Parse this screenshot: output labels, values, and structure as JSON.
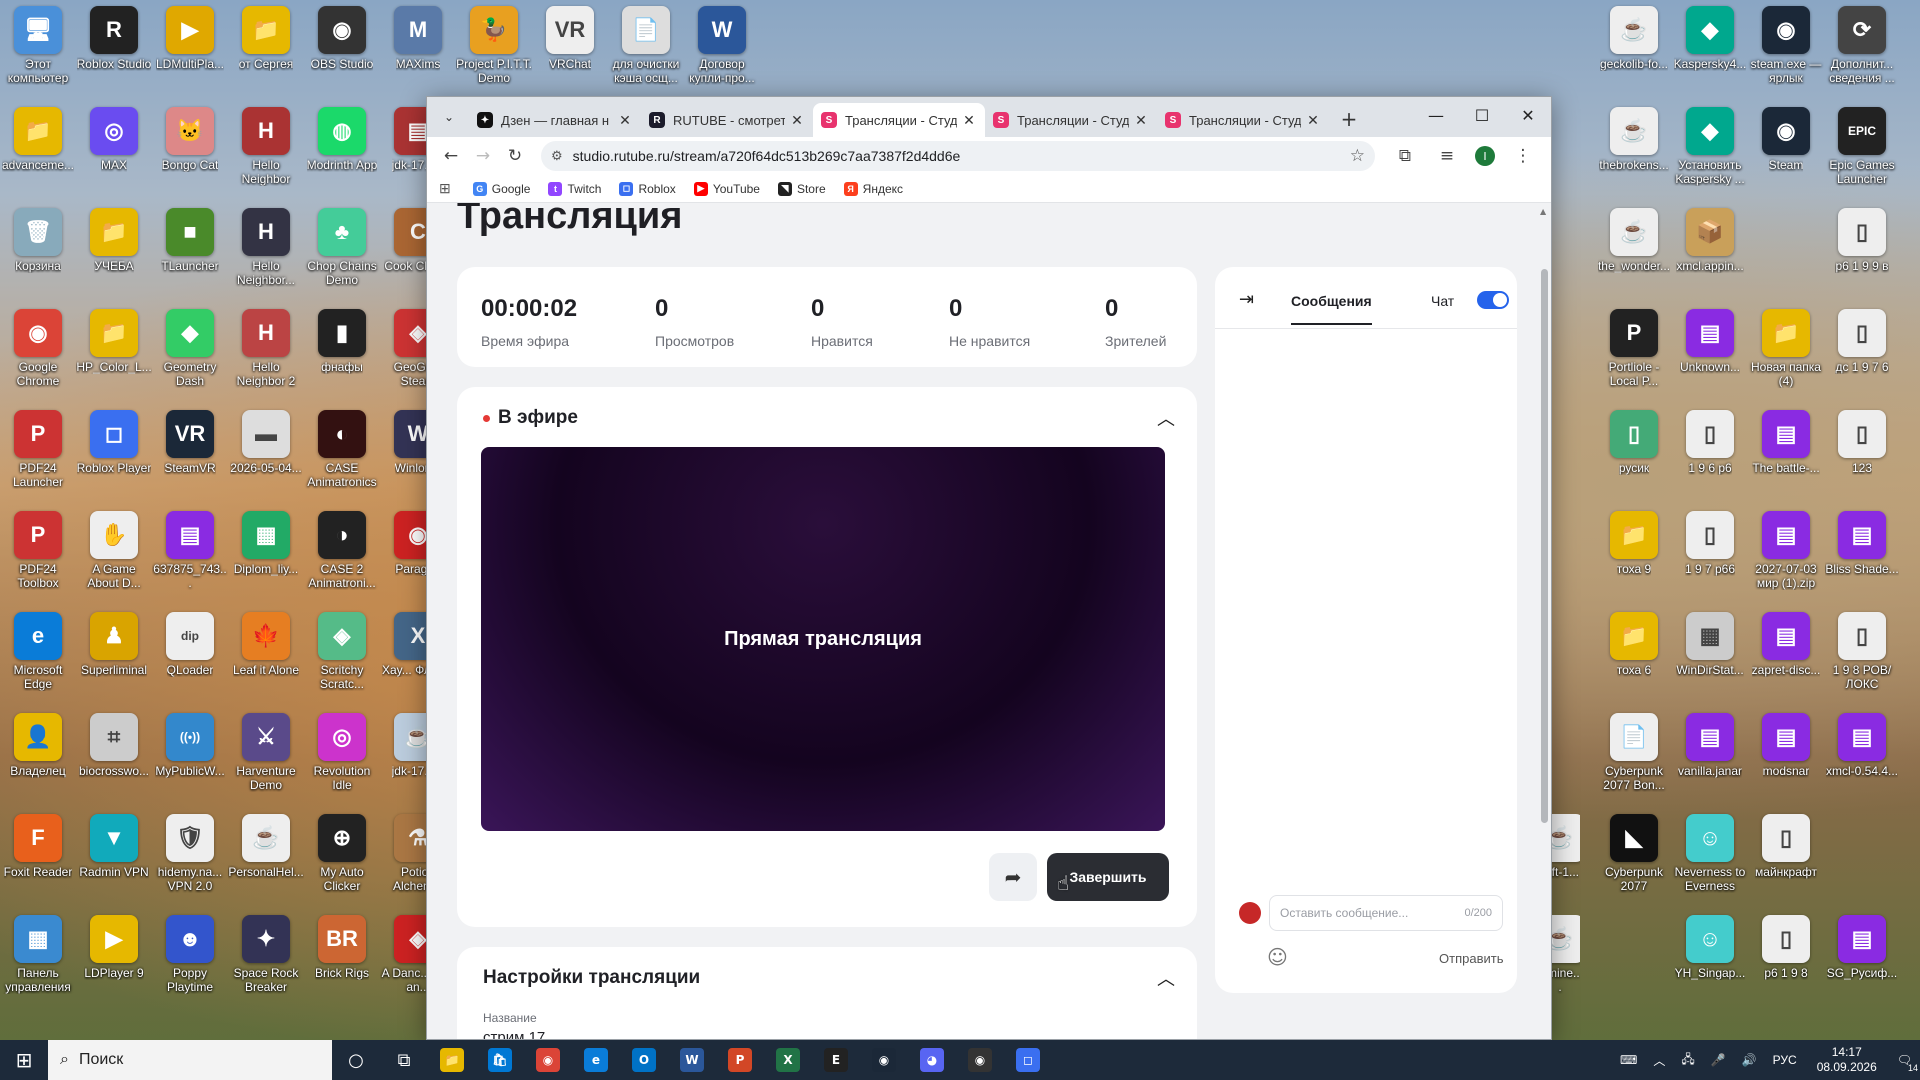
{
  "desktop": {
    "left_icons": [
      {
        "label": "Этот компьютер",
        "color": "#4a90d9",
        "glyph": "🖥",
        "col": 0,
        "row": 0
      },
      {
        "label": "Roblox Studio",
        "color": "#222",
        "glyph": "R",
        "col": 1,
        "row": 0
      },
      {
        "label": "LDMultiPla...",
        "color": "#e0a800",
        "glyph": "▶",
        "col": 2,
        "row": 0
      },
      {
        "label": "от Сергея",
        "color": "#e6b800",
        "glyph": "📁",
        "col": 3,
        "row": 0
      },
      {
        "label": "OBS Studio",
        "color": "#333",
        "glyph": "◉",
        "col": 4,
        "row": 0
      },
      {
        "label": "MAXims",
        "color": "#5a7aa8",
        "glyph": "M",
        "col": 5,
        "row": 0
      },
      {
        "label": "Project P.I.T.T. Demo",
        "color": "#e8a020",
        "glyph": "🦆",
        "col": 6,
        "row": 0
      },
      {
        "label": "VRChat",
        "color": "#eee",
        "glyph": "VR",
        "col": 7,
        "row": 0
      },
      {
        "label": "для очистки кэша осщ...",
        "color": "#ddd",
        "glyph": "📄",
        "col": 8,
        "row": 0
      },
      {
        "label": "Договор купли-про...",
        "color": "#2b579a",
        "glyph": "W",
        "col": 9,
        "row": 0
      },
      {
        "label": "advanceme...",
        "color": "#e6b800",
        "glyph": "📁",
        "col": 0,
        "row": 1
      },
      {
        "label": "MAX",
        "color": "#6a4cf0",
        "glyph": "◎",
        "col": 1,
        "row": 1
      },
      {
        "label": "Bongo Cat",
        "color": "#d88",
        "glyph": "🐱",
        "col": 2,
        "row": 1
      },
      {
        "label": "Hello Neighbor",
        "color": "#a33",
        "glyph": "H",
        "col": 3,
        "row": 1
      },
      {
        "label": "Modrinth App",
        "color": "#1bd96a",
        "glyph": "◍",
        "col": 4,
        "row": 1
      },
      {
        "label": "jdk-17.0...",
        "color": "#a33",
        "glyph": "▤",
        "col": 5,
        "row": 1
      },
      {
        "label": "Корзина",
        "color": "#8ab",
        "glyph": "🗑",
        "col": 0,
        "row": 2
      },
      {
        "label": "УЧЕБА",
        "color": "#e6b800",
        "glyph": "📁",
        "col": 1,
        "row": 2
      },
      {
        "label": "TLauncher",
        "color": "#4a8a2a",
        "glyph": "■",
        "col": 2,
        "row": 2
      },
      {
        "label": "Hello Neighbor...",
        "color": "#334",
        "glyph": "H",
        "col": 3,
        "row": 2
      },
      {
        "label": "Chop Chains Demo",
        "color": "#4c9",
        "glyph": "♣",
        "col": 4,
        "row": 2
      },
      {
        "label": "Cook Click...",
        "color": "#a63",
        "glyph": "C",
        "col": 5,
        "row": 2
      },
      {
        "label": "Google Chrome",
        "color": "#db4437",
        "glyph": "◉",
        "col": 0,
        "row": 3
      },
      {
        "label": "HP_Color_L...",
        "color": "#e6b800",
        "glyph": "📁",
        "col": 1,
        "row": 3
      },
      {
        "label": "Geometry Dash",
        "color": "#3c6",
        "glyph": "◆",
        "col": 2,
        "row": 3
      },
      {
        "label": "Hello Neighbor 2",
        "color": "#b44",
        "glyph": "H",
        "col": 3,
        "row": 3
      },
      {
        "label": "фнафы",
        "color": "#222",
        "glyph": "▮",
        "col": 4,
        "row": 3
      },
      {
        "label": "GeoGu... Steam",
        "color": "#c33",
        "glyph": "◈",
        "col": 5,
        "row": 3
      },
      {
        "label": "PDF24 Launcher",
        "color": "#c33",
        "glyph": "P",
        "col": 0,
        "row": 4
      },
      {
        "label": "Roblox Player",
        "color": "#3a6ff0",
        "glyph": "◻",
        "col": 1,
        "row": 4
      },
      {
        "label": "SteamVR",
        "color": "#1b2838",
        "glyph": "VR",
        "col": 2,
        "row": 4
      },
      {
        "label": "2026-05-04...",
        "color": "#ddd",
        "glyph": "▬",
        "col": 3,
        "row": 4
      },
      {
        "label": "CASE Animatronics",
        "color": "#311",
        "glyph": "◐",
        "col": 4,
        "row": 4
      },
      {
        "label": "Winlon...",
        "color": "#335",
        "glyph": "W",
        "col": 5,
        "row": 4
      },
      {
        "label": "PDF24 Toolbox",
        "color": "#c33",
        "glyph": "P",
        "col": 0,
        "row": 5
      },
      {
        "label": "A Game About D...",
        "color": "#eee",
        "glyph": "✋",
        "col": 1,
        "row": 5
      },
      {
        "label": "637875_743...",
        "color": "#8a2be2",
        "glyph": "▤",
        "col": 2,
        "row": 5
      },
      {
        "label": "Diplom_liy...",
        "color": "#2a6",
        "glyph": "▦",
        "col": 3,
        "row": 5
      },
      {
        "label": "CASE 2 Animatroni...",
        "color": "#222",
        "glyph": "◑",
        "col": 4,
        "row": 5
      },
      {
        "label": "Paragr...",
        "color": "#c22",
        "glyph": "◉",
        "col": 5,
        "row": 5
      },
      {
        "label": "Microsoft Edge",
        "color": "#0a7cd8",
        "glyph": "e",
        "col": 0,
        "row": 6
      },
      {
        "label": "Superliminal",
        "color": "#d9a400",
        "glyph": "♟",
        "col": 1,
        "row": 6
      },
      {
        "label": "QLoader",
        "color": "#eee",
        "glyph": "dip",
        "col": 2,
        "row": 6
      },
      {
        "label": "Leaf it Alone",
        "color": "#e67e22",
        "glyph": "🍁",
        "col": 3,
        "row": 6
      },
      {
        "label": "Scritchy Scratc...",
        "color": "#5b8",
        "glyph": "◈",
        "col": 4,
        "row": 6
      },
      {
        "label": "Xay... Флип...",
        "color": "#468",
        "glyph": "X",
        "col": 5,
        "row": 6
      },
      {
        "label": "Владелец",
        "color": "#e6b800",
        "glyph": "👤",
        "col": 0,
        "row": 7
      },
      {
        "label": "biocrosswo...",
        "color": "#ccc",
        "glyph": "⌗",
        "col": 1,
        "row": 7
      },
      {
        "label": "MyPublicW...",
        "color": "#38c",
        "glyph": "((•))",
        "col": 2,
        "row": 7
      },
      {
        "label": "Harventure Demo",
        "color": "#5a4a8a",
        "glyph": "⚔",
        "col": 3,
        "row": 7
      },
      {
        "label": "Revolution Idle",
        "color": "#c3c",
        "glyph": "◎",
        "col": 4,
        "row": 7
      },
      {
        "label": "jdk-17.0...",
        "color": "#bcd",
        "glyph": "☕",
        "col": 5,
        "row": 7
      },
      {
        "label": "Foxit Reader",
        "color": "#e8601c",
        "glyph": "F",
        "col": 0,
        "row": 8
      },
      {
        "label": "Radmin VPN",
        "color": "#1ab",
        "glyph": "▼",
        "col": 1,
        "row": 8
      },
      {
        "label": "hidemy.na... VPN 2.0",
        "color": "#eee",
        "glyph": "🛡",
        "col": 2,
        "row": 8
      },
      {
        "label": "PersonalHel...",
        "color": "#eee",
        "glyph": "☕",
        "col": 3,
        "row": 8
      },
      {
        "label": "My Auto Clicker",
        "color": "#222",
        "glyph": "⊕",
        "col": 4,
        "row": 8
      },
      {
        "label": "Potion Alchem...",
        "color": "#a74",
        "glyph": "⚗",
        "col": 5,
        "row": 8
      },
      {
        "label": "Панель управления",
        "color": "#3a8ad0",
        "glyph": "▦",
        "col": 0,
        "row": 9
      },
      {
        "label": "LDPlayer 9",
        "color": "#e6b800",
        "glyph": "▶",
        "col": 1,
        "row": 9
      },
      {
        "label": "Poppy Playtime",
        "color": "#3355cc",
        "glyph": "☻",
        "col": 2,
        "row": 9
      },
      {
        "label": "Space Rock Breaker",
        "color": "#335",
        "glyph": "✦",
        "col": 3,
        "row": 9
      },
      {
        "label": "Brick Rigs",
        "color": "#c63",
        "glyph": "BR",
        "col": 4,
        "row": 9
      },
      {
        "label": "A Danc... Fire an...",
        "color": "#c22",
        "glyph": "◈",
        "col": 5,
        "row": 9
      }
    ],
    "right_icons": [
      {
        "label": "geckolib-fo...",
        "color": "#eee",
        "glyph": "☕",
        "col": 0,
        "row": 0
      },
      {
        "label": "Kaspersky4...",
        "color": "#00a88e",
        "glyph": "◆",
        "col": 1,
        "row": 0
      },
      {
        "label": "steam.exe — ярлык",
        "color": "#1b2838",
        "glyph": "◉",
        "col": 2,
        "row": 0
      },
      {
        "label": "Дополнит... сведения ...",
        "color": "#444",
        "glyph": "⟳",
        "col": 3,
        "row": 0
      },
      {
        "label": "thebrokens...",
        "color": "#eee",
        "glyph": "☕",
        "col": 0,
        "row": 1
      },
      {
        "label": "Установить Kaspersky ...",
        "color": "#00a88e",
        "glyph": "◆",
        "col": 1,
        "row": 1
      },
      {
        "label": "Steam",
        "color": "#1b2838",
        "glyph": "◉",
        "col": 2,
        "row": 1
      },
      {
        "label": "Epic Games Launcher",
        "color": "#222",
        "glyph": "EPIC",
        "col": 3,
        "row": 1
      },
      {
        "label": "the_wonder...",
        "color": "#eee",
        "glyph": "☕",
        "col": 0,
        "row": 2
      },
      {
        "label": "xmcl.appin...",
        "color": "#c9a05a",
        "glyph": "📦",
        "col": 1,
        "row": 2
      },
      {
        "label": "р6 1 9 9 в",
        "color": "#eee",
        "glyph": "▯",
        "col": 3,
        "row": 2
      },
      {
        "label": "Portliole - Local P...",
        "color": "#222",
        "glyph": "P",
        "col": 0,
        "row": 3
      },
      {
        "label": "Unknown...",
        "color": "#8a2be2",
        "glyph": "▤",
        "col": 1,
        "row": 3
      },
      {
        "label": "Новая папка (4)",
        "color": "#e6b800",
        "glyph": "📁",
        "col": 2,
        "row": 3
      },
      {
        "label": "дс 1 9 7 6",
        "color": "#eee",
        "glyph": "▯",
        "col": 3,
        "row": 3
      },
      {
        "label": "русик",
        "color": "#4a7",
        "glyph": "▯",
        "col": 0,
        "row": 4
      },
      {
        "label": "1 9 6 р6",
        "color": "#eee",
        "glyph": "▯",
        "col": 1,
        "row": 4
      },
      {
        "label": "The battle-...",
        "color": "#8a2be2",
        "glyph": "▤",
        "col": 2,
        "row": 4
      },
      {
        "label": "123",
        "color": "#eee",
        "glyph": "▯",
        "col": 3,
        "row": 4
      },
      {
        "label": "тоха 9",
        "color": "#e6b800",
        "glyph": "📁",
        "col": 0,
        "row": 5
      },
      {
        "label": "1 9 7 р66",
        "color": "#eee",
        "glyph": "▯",
        "col": 1,
        "row": 5
      },
      {
        "label": "2027-07-03 мир (1).zip",
        "color": "#8a2be2",
        "glyph": "▤",
        "col": 2,
        "row": 5
      },
      {
        "label": "Bliss Shade...",
        "color": "#8a2be2",
        "glyph": "▤",
        "col": 3,
        "row": 5
      },
      {
        "label": "тоха 6",
        "color": "#e6b800",
        "glyph": "📁",
        "col": 0,
        "row": 6
      },
      {
        "label": "WinDirStat...",
        "color": "#ccc",
        "glyph": "▦",
        "col": 1,
        "row": 6
      },
      {
        "label": "zapret-disc...",
        "color": "#8a2be2",
        "glyph": "▤",
        "col": 2,
        "row": 6
      },
      {
        "label": "1 9 8 РОВ/ЛОКС",
        "color": "#eee",
        "glyph": "▯",
        "col": 3,
        "row": 6
      },
      {
        "label": "Cyberpunk 2077 Bon...",
        "color": "#eee",
        "glyph": "📄",
        "col": 0,
        "row": 7
      },
      {
        "label": "vanilla.janar",
        "color": "#8a2be2",
        "glyph": "▤",
        "col": 1,
        "row": 7
      },
      {
        "label": "modsnar",
        "color": "#8a2be2",
        "glyph": "▤",
        "col": 2,
        "row": 7
      },
      {
        "label": "xmcl-0.54.4...",
        "color": "#8a2be2",
        "glyph": "▤",
        "col": 3,
        "row": 7
      },
      {
        "label": "Cyberpunk 2077",
        "color": "#111",
        "glyph": "◣",
        "col": 0,
        "row": 8
      },
      {
        "label": "Neverness to Everness",
        "color": "#4cc",
        "glyph": "☺",
        "col": 1,
        "row": 8
      },
      {
        "label": "майнкрафт",
        "color": "#eee",
        "glyph": "▯",
        "col": 2,
        "row": 8
      },
      {
        "label": "YH_Singap...",
        "color": "#4cc",
        "glyph": "☺",
        "col": 1,
        "row": 9
      },
      {
        "label": "р6 1 9 8",
        "color": "#eee",
        "glyph": "▯",
        "col": 2,
        "row": 9
      },
      {
        "label": "SG_Русиф...",
        "color": "#8a2be2",
        "glyph": "▤",
        "col": 3,
        "row": 9
      }
    ],
    "partial_icons": [
      {
        "label": "raft-1...",
        "row": 8
      },
      {
        "label": "_mine...",
        "row": 9
      }
    ]
  },
  "browser": {
    "tabs": [
      {
        "title": "Дзен — главная н",
        "fav_color": "#111",
        "fav_glyph": "✦",
        "active": false
      },
      {
        "title": "RUTUBE - смотреть",
        "fav_color": "#1b1b2b",
        "fav_glyph": "R",
        "active": false
      },
      {
        "title": "Трансляции - Студ",
        "fav_color": "#e8336e",
        "fav_glyph": "S",
        "active": true
      },
      {
        "title": "Трансляции - Студ",
        "fav_color": "#e8336e",
        "fav_glyph": "S",
        "active": false
      },
      {
        "title": "Трансляции - Студ",
        "fav_color": "#e8336e",
        "fav_glyph": "S",
        "active": false
      }
    ],
    "url": "studio.rutube.ru/stream/a720f64dc513b269c7aa7387f2d4dd6e",
    "bookmarks": [
      {
        "label": "Google",
        "color": "#4285f4",
        "glyph": "G"
      },
      {
        "label": "Twitch",
        "color": "#9146ff",
        "glyph": "t"
      },
      {
        "label": "Roblox",
        "color": "#3a6ff0",
        "glyph": "◻"
      },
      {
        "label": "YouTube",
        "color": "#ff0000",
        "glyph": "▶"
      },
      {
        "label": "Store",
        "color": "#222",
        "glyph": "◥"
      },
      {
        "label": "Яндекс",
        "color": "#fc3f1d",
        "glyph": "Я"
      }
    ],
    "profile_initial": "I"
  },
  "page": {
    "title": "Трансляция",
    "stats": [
      {
        "value": "00:00:02",
        "caption": "Время эфира"
      },
      {
        "value": "0",
        "caption": "Просмотров"
      },
      {
        "value": "0",
        "caption": "Нравится"
      },
      {
        "value": "0",
        "caption": "Не нравится"
      },
      {
        "value": "0",
        "caption": "Зрителей"
      }
    ],
    "live": {
      "heading": "В эфире",
      "player_text": "Прямая трансляция",
      "end_label": "Завершить"
    },
    "settings": {
      "heading": "Настройки трансляции",
      "name_label": "Название",
      "name_value": "стрим 17"
    },
    "chat": {
      "tab_label": "Сообщения",
      "chat_toggle_label": "Чат",
      "chat_enabled": true,
      "input_placeholder": "Оставить сообщение...",
      "counter": "0/200",
      "send_label": "Отправить"
    }
  },
  "taskbar": {
    "search_placeholder": "Поиск",
    "apps": [
      {
        "name": "file-explorer",
        "color": "#e6b800",
        "glyph": "📁"
      },
      {
        "name": "store",
        "color": "#0078d4",
        "glyph": "🛍"
      },
      {
        "name": "chrome",
        "color": "#db4437",
        "glyph": "◉"
      },
      {
        "name": "edge",
        "color": "#0a7cd8",
        "glyph": "e"
      },
      {
        "name": "outlook",
        "color": "#0072c6",
        "glyph": "O"
      },
      {
        "name": "word",
        "color": "#2b579a",
        "glyph": "W"
      },
      {
        "name": "powerpoint",
        "color": "#d24726",
        "glyph": "P"
      },
      {
        "name": "excel",
        "color": "#217346",
        "glyph": "X"
      },
      {
        "name": "epic",
        "color": "#222",
        "glyph": "E"
      },
      {
        "name": "steam",
        "color": "#1b2838",
        "glyph": "◉"
      },
      {
        "name": "discord",
        "color": "#5865f2",
        "glyph": "◕"
      },
      {
        "name": "obs",
        "color": "#333",
        "glyph": "◉"
      },
      {
        "name": "roblox",
        "color": "#3a6ff0",
        "glyph": "◻"
      }
    ],
    "lang": "РУС",
    "time": "14:17",
    "date": "08.09.2026",
    "notif_count": "14"
  }
}
